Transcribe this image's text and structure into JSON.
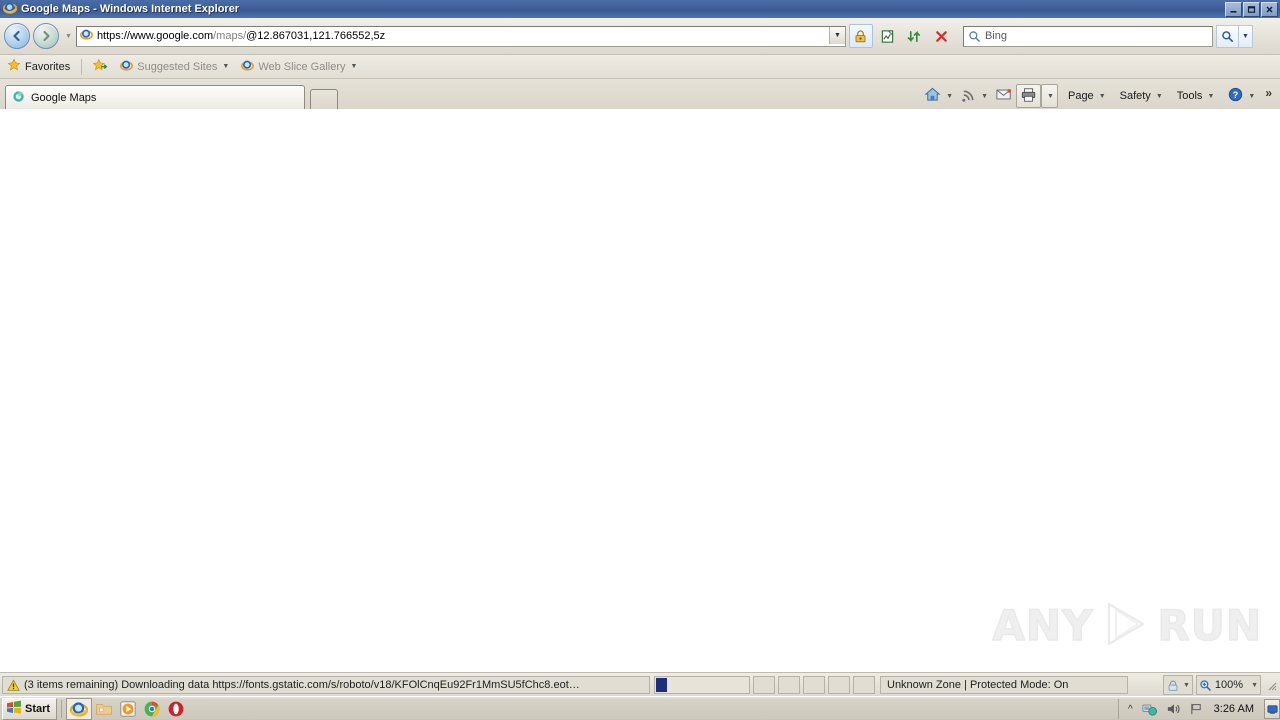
{
  "window": {
    "title": "Google Maps - Windows Internet Explorer",
    "app_icon": "internet-explorer-icon",
    "controls": {
      "minimize": "_",
      "maximize": "❐",
      "close": "✕"
    }
  },
  "navigation": {
    "back_label": "←",
    "forward_label": "→",
    "history_caret": "▼",
    "address": {
      "favicon": "internet-explorer-icon",
      "scheme": "https://www.",
      "domain": "google.com",
      "path": "/maps/",
      "query": "@12.867031,121.766552,5z",
      "full": "https://www.google.com/maps/@12.867031,121.766552,5z",
      "dropdown": "▼"
    },
    "buttons": [
      {
        "name": "ssl-lock-icon",
        "tip": "Security Report"
      },
      {
        "name": "compatibility-view-icon",
        "tip": "Compatibility View"
      },
      {
        "name": "refresh-icon",
        "tip": "Refresh"
      },
      {
        "name": "stop-icon",
        "tip": "Stop"
      }
    ],
    "search": {
      "placeholder": "Bing",
      "value": "",
      "go_icon": "search-icon",
      "dropdown": "▼"
    }
  },
  "favorites_bar": {
    "favorites_label": "Favorites",
    "items": [
      {
        "label": "Suggested Sites",
        "icon": "internet-explorer-icon",
        "caret": "▼"
      },
      {
        "label": "Web Slice Gallery",
        "icon": "internet-explorer-icon",
        "caret": "▼"
      }
    ],
    "add_to_favorites_icon": "add-favorite-star-icon"
  },
  "tabs": {
    "items": [
      {
        "label": "Google Maps",
        "icon": "google-maps-favicon",
        "active": true
      }
    ],
    "new_tab_label": ""
  },
  "command_bar": {
    "home_icon": "home-icon",
    "feeds_icon": "rss-feed-icon",
    "mail_icon": "mail-icon",
    "print_icon": "print-icon",
    "menus": [
      {
        "label": "Page",
        "caret": "▼"
      },
      {
        "label": "Safety",
        "caret": "▼"
      },
      {
        "label": "Tools",
        "caret": "▼"
      }
    ],
    "help_icon": "help-icon",
    "help_caret": "▼",
    "overflow": "»"
  },
  "content": {
    "blank": "",
    "watermark": {
      "left": "ANY",
      "right": "RUN",
      "logo": "anyrun-play-logo"
    }
  },
  "status_bar": {
    "warning_icon": "warning-icon",
    "message": "(3 items remaining) Downloading data https://fonts.gstatic.com/s/roboto/v18/KFOlCnqEu92Fr1MmSU5fChc8.eot…",
    "progress_percent": 12,
    "zone": "Unknown Zone | Protected Mode: On",
    "privacy_icon": "privacy-report-icon",
    "privacy_caret": "▼",
    "zoom_icon": "zoom-icon",
    "zoom_level": "100%",
    "zoom_caret": "▼"
  },
  "taskbar": {
    "start_label": "Start",
    "start_icon": "windows-flag-icon",
    "quick_launch": [
      {
        "name": "internet-explorer-icon",
        "pressed": true
      },
      {
        "name": "file-explorer-icon",
        "pressed": false
      },
      {
        "name": "media-player-icon",
        "pressed": false
      },
      {
        "name": "chrome-icon",
        "pressed": false
      },
      {
        "name": "opera-icon",
        "pressed": false
      }
    ],
    "tray": {
      "expand": "«",
      "network_icon": "network-icon",
      "volume_icon": "volume-icon",
      "action_center_icon": "flag-icon",
      "time": "3:26 AM",
      "show_desktop_icon": "show-desktop-icon"
    }
  }
}
